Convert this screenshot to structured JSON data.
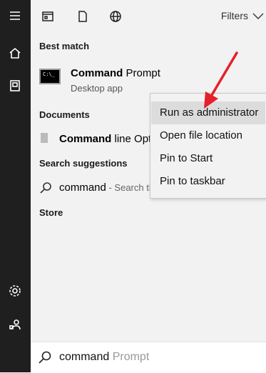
{
  "topbar": {
    "filters_label": "Filters",
    "icons": [
      "apps-icon",
      "document-icon",
      "globe-icon",
      "chevron-down-icon"
    ]
  },
  "rail": {
    "icons": [
      "hamburger-icon",
      "home-icon",
      "documents-icon",
      "settings-icon",
      "user-icon"
    ]
  },
  "sections": {
    "best_match": "Best match",
    "documents": "Documents",
    "suggestions": "Search suggestions",
    "store": "Store"
  },
  "best_match_item": {
    "title_bold": "Command",
    "title_rest": " Prompt",
    "subtitle": "Desktop app",
    "icon": "command-prompt-icon",
    "icon_text": "C:\\_"
  },
  "document_item": {
    "title_bold": "Command",
    "title_rest": " line Opt"
  },
  "suggestion_item": {
    "query": "command",
    "hint": " - Search th"
  },
  "context_menu": {
    "items": [
      "Run as administrator",
      "Open file location",
      "Pin to Start",
      "Pin to taskbar"
    ],
    "highlighted_index": 0
  },
  "search": {
    "typed": "command",
    "autocomplete": " Prompt"
  },
  "colors": {
    "rail": "#1f1f1f",
    "panel": "#f2f2f2",
    "menu_highlight": "#dcdcdc",
    "arrow": "#e5202a"
  }
}
